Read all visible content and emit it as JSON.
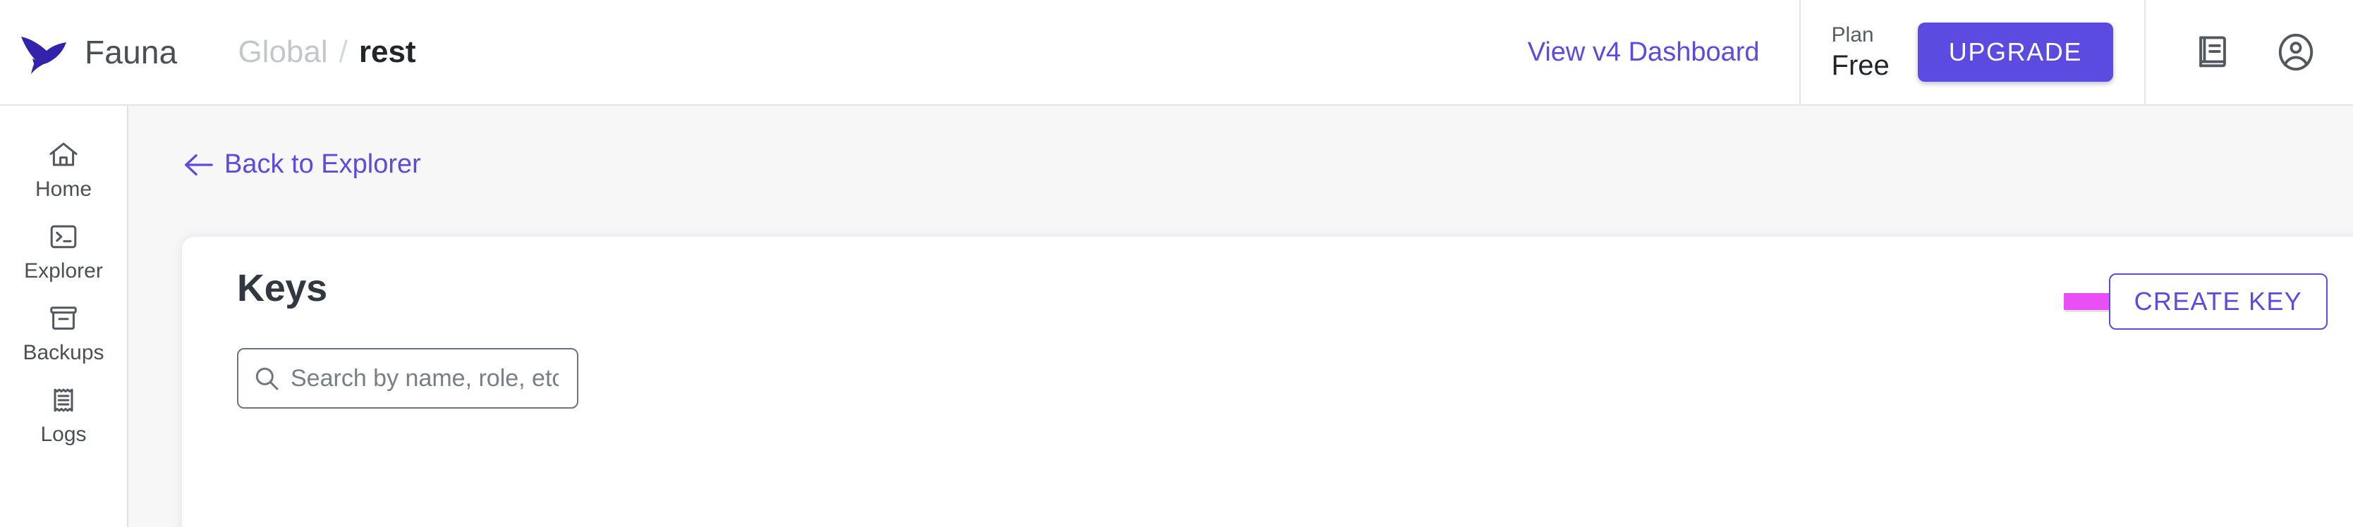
{
  "header": {
    "logo_icon": "fauna-bird-logo",
    "brand_name": "Fauna",
    "breadcrumb": {
      "parent": "Global",
      "separator": "/",
      "current": "rest"
    },
    "v4_dashboard_link": "View v4 Dashboard",
    "plan_label": "Plan",
    "plan_value": "Free",
    "upgrade_label": "UPGRADE",
    "icons": [
      {
        "name": "docs-book-icon"
      },
      {
        "name": "account-user-icon"
      }
    ]
  },
  "sidebar": {
    "items": [
      {
        "label": "Home",
        "icon": "home-icon"
      },
      {
        "label": "Explorer",
        "icon": "terminal-icon"
      },
      {
        "label": "Backups",
        "icon": "archive-box-icon"
      },
      {
        "label": "Logs",
        "icon": "receipt-log-icon"
      }
    ]
  },
  "content": {
    "back_link": "Back to Explorer",
    "card": {
      "title": "Keys",
      "create_key_label": "CREATE KEY",
      "search": {
        "placeholder": "Search by name, role, etc.",
        "value": ""
      }
    }
  },
  "colors": {
    "brand_purple": "#5b4be0",
    "logo_indigo": "#3123ab",
    "annotation_magenta": "#ea4ef5",
    "page_background": "#f7f7f8",
    "card_background": "#ffffff",
    "text_dark": "#22262b",
    "text_muted": "#c3c7cc",
    "border_gray": "#e3e5e8"
  }
}
